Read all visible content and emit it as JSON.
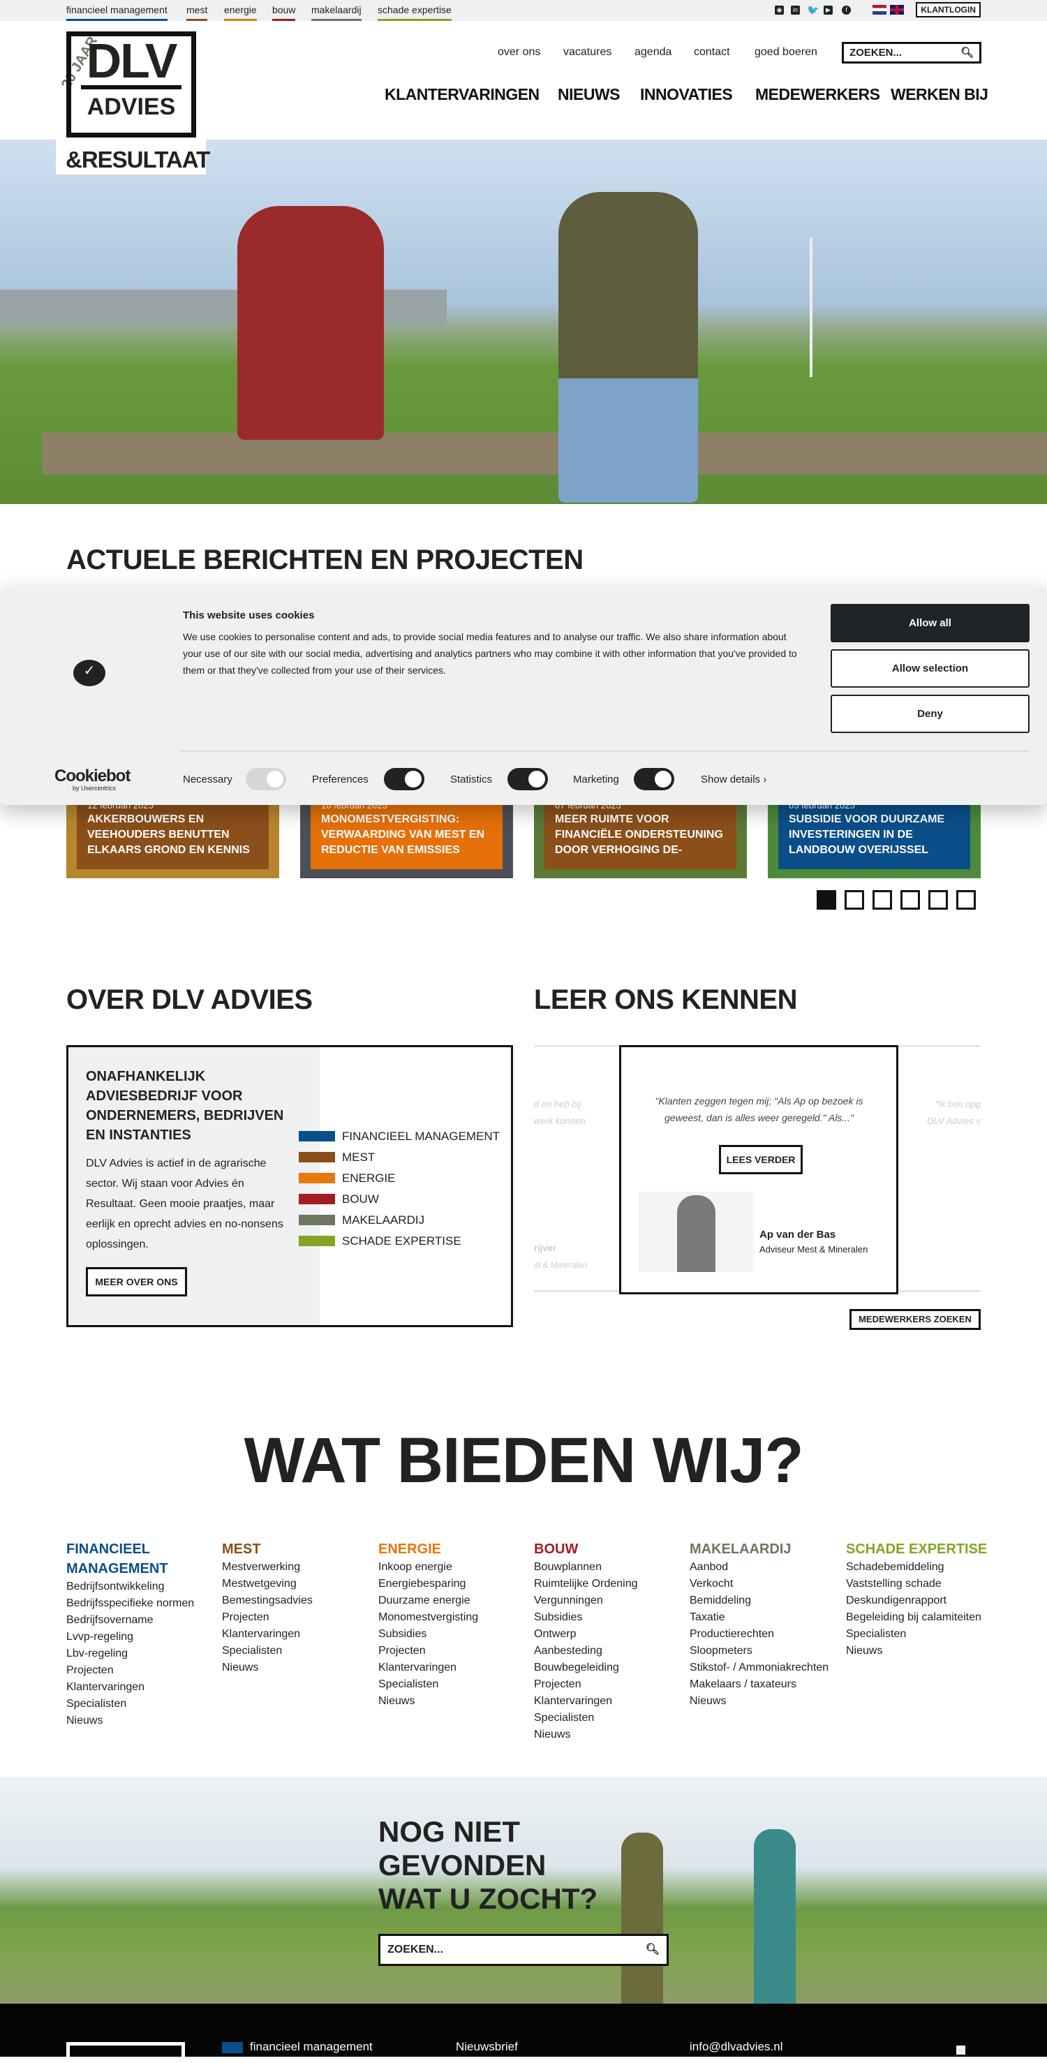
{
  "topbar": {
    "segments": [
      {
        "label": "financieel management",
        "color": "#0b4f8a"
      },
      {
        "label": "mest",
        "color": "#8b4f1a"
      },
      {
        "label": "energie",
        "color": "#e6780e"
      },
      {
        "label": "bouw",
        "color": "#a31d24"
      },
      {
        "label": "makelaardij",
        "color": "#6e7561"
      },
      {
        "label": "schade expertise",
        "color": "#84a523"
      }
    ],
    "social_icons": [
      "rss-icon",
      "linkedin-icon",
      "twitter-icon",
      "youtube-icon",
      "facebook-icon"
    ],
    "flags": [
      "flag-nl-icon",
      "flag-uk-icon"
    ],
    "klantlogin": "KLANTLOGIN"
  },
  "logo": {
    "badge": "20 JAAR",
    "name": "DLV",
    "sub": "ADVIES",
    "tagline": "&RESULTAAT"
  },
  "util_nav": [
    "over ons",
    "vacatures",
    "agenda",
    "contact",
    "goed boeren"
  ],
  "search": {
    "placeholder": "ZOEKEN..."
  },
  "main_nav": [
    "KLANTERVARINGEN",
    "NIEUWS",
    "INNOVATIES",
    "MEDEWERKERS",
    "WERKEN BIJ"
  ],
  "news": {
    "heading": "ACTUELE BERICHTEN EN PROJECTEN",
    "cards": [
      {
        "date": "12 februari 2025",
        "title": "AKKERBOUWERS EN VEEHOUDERS BENUTTEN ELKAARS GROND EN KENNIS",
        "color": "#8b4f1a"
      },
      {
        "date": "10 februari 2025",
        "title": "MONOMESTVERGISTING: VERWAARDING VAN MEST EN REDUCTIE VAN EMISSIES",
        "color": "#e6700a"
      },
      {
        "date": "07 februari 2025",
        "title": "MEER RUIMTE VOOR FINANCIËLE ONDERSTEUNING DOOR VERHOGING DE-",
        "color": "#8b4f1a"
      },
      {
        "date": "05 februari 2025",
        "title": "SUBSIDIE VOOR DUURZAME INVESTERINGEN IN DE LANDBOUW OVERIJSSEL",
        "color": "#0b4f8a"
      }
    ],
    "pages": 6,
    "active_page": 1
  },
  "cookie": {
    "title": "This website uses cookies",
    "text": "We use cookies to personalise content and ads, to provide social media features and to analyse our traffic. We also share information about your use of our site with our social media, advertising and analytics partners who may combine it with other information that you've provided to them or that they've collected from your use of their services.",
    "allow_all": "Allow all",
    "allow_selection": "Allow selection",
    "deny": "Deny",
    "brand": "Cookiebot",
    "brand_sub": "by Usercentrics",
    "toggles": [
      {
        "label": "Necessary",
        "on": true,
        "disabled": true
      },
      {
        "label": "Preferences",
        "on": true
      },
      {
        "label": "Statistics",
        "on": true
      },
      {
        "label": "Marketing",
        "on": true
      }
    ],
    "show_details": "Show details"
  },
  "about": {
    "heading": "OVER DLV ADVIES",
    "title": "ONAFHANKELIJK ADVIESBEDRIJF VOOR ONDERNEMERS, BEDRIJVEN EN INSTANTIES",
    "text": "DLV Advies is actief in de agrarische sector. Wij staan voor Advies én Resultaat. Geen mooie praatjes, maar eerlijk en oprecht advies en no-nonsens oplossingen.",
    "button": "MEER OVER ONS",
    "categories": [
      {
        "label": "FINANCIEEL MANAGEMENT",
        "color": "#0b4f8a"
      },
      {
        "label": "MEST",
        "color": "#8b4f1a"
      },
      {
        "label": "ENERGIE",
        "color": "#e6780e"
      },
      {
        "label": "BOUW",
        "color": "#a31d24"
      },
      {
        "label": "MAKELAARDIJ",
        "color": "#6e7561"
      },
      {
        "label": "SCHADE EXPERTISE",
        "color": "#84a523"
      }
    ]
  },
  "team": {
    "heading": "LEER ONS KENNEN",
    "quote": "\"Klanten zeggen tegen mij; \"Als Ap op bezoek is geweest, dan is alles weer geregeld.\" Als...\"",
    "read_more": "LEES VERDER",
    "name": "Ap van der Bas",
    "role": "Adviseur Mest & Mineralen",
    "prev_fragment": "d en heb bij werk kunnen",
    "prev_name": "rijver",
    "prev_role": "st & Mineralen",
    "next_fragment": "\"Ik ben opg DLV Advies v",
    "search_button": "MEDEWERKERS ZOEKEN"
  },
  "offer": {
    "heading": "WAT BIEDEN WIJ?",
    "columns": [
      {
        "title": "FINANCIEEL MANAGEMENT",
        "color": "#0b4f8a",
        "items": [
          "Bedrijfsontwikkeling",
          "Bedrijfsspecifieke normen",
          "Bedrijfsovername",
          "Lvvp-regeling",
          "Lbv-regeling",
          "Projecten",
          "Klantervaringen",
          "Specialisten",
          "Nieuws"
        ]
      },
      {
        "title": "MEST",
        "color": "#8b4f1a",
        "items": [
          "Mestverwerking",
          "Mestwetgeving",
          "Bemestingsadvies",
          "Projecten",
          "Klantervaringen",
          "Specialisten",
          "Nieuws"
        ]
      },
      {
        "title": "ENERGIE",
        "color": "#e6780e",
        "items": [
          "Inkoop energie",
          "Energiebesparing",
          "Duurzame energie",
          "Monomestvergisting",
          "Subsidies",
          "Projecten",
          "Klantervaringen",
          "Specialisten",
          "Nieuws"
        ]
      },
      {
        "title": "BOUW",
        "color": "#a31d24",
        "items": [
          "Bouwplannen",
          "Ruimtelijke Ordening",
          "Vergunningen",
          "Subsidies",
          "Ontwerp",
          "Aanbesteding",
          "Bouwbegeleiding",
          "Projecten",
          "Klantervaringen",
          "Specialisten",
          "Nieuws"
        ]
      },
      {
        "title": "MAKELAARDIJ",
        "color": "#6e7561",
        "items": [
          "Aanbod",
          "Verkocht",
          "Bemiddeling",
          "Taxatie",
          "Productierechten",
          "Sloopmeters",
          "Stikstof- / Ammoniakrechten",
          "Makelaars / taxateurs",
          "Nieuws"
        ]
      },
      {
        "title": "SCHADE EXPERTISE",
        "color": "#84a523",
        "items": [
          "Schadebemiddeling",
          "Vaststelling schade",
          "Deskundigenrapport",
          "Begeleiding bij calamiteiten",
          "Specialisten",
          "Nieuws"
        ]
      }
    ]
  },
  "banner": {
    "heading": "NOG NIET GEVONDEN WAT U ZOCHT?",
    "search_placeholder": "ZOEKEN..."
  },
  "footer": {
    "category": "financieel management",
    "category_color": "#0b4f8a",
    "newsletter": "Nieuwsbrief",
    "email": "info@dlvadvies.nl"
  }
}
